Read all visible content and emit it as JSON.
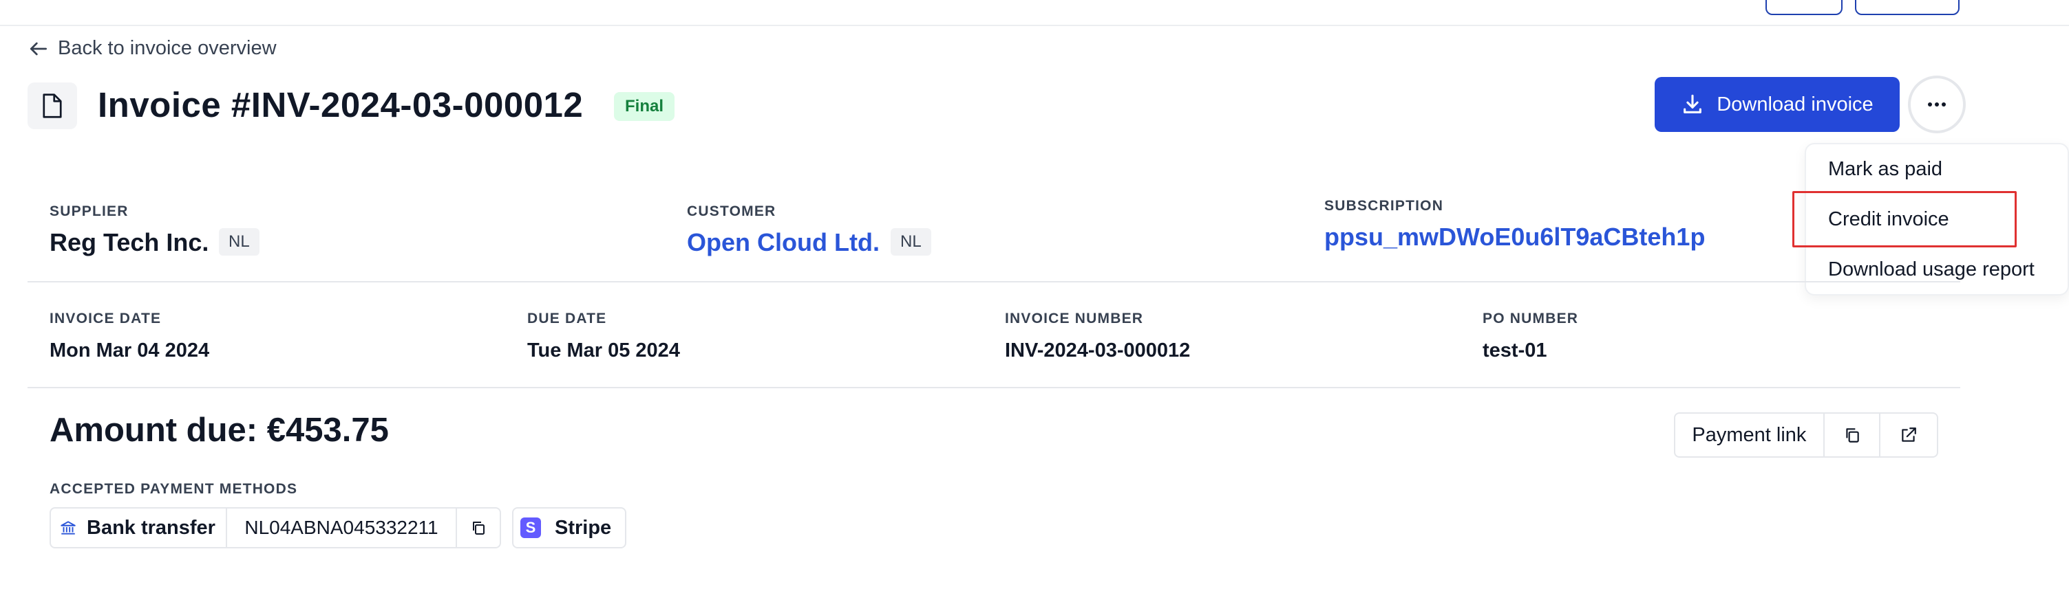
{
  "back_link": {
    "label": "Back to invoice overview"
  },
  "invoice": {
    "title": "Invoice #INV-2024-03-000012",
    "status": "Final"
  },
  "actions": {
    "download_label": "Download invoice",
    "more_menu": [
      "Mark as paid",
      "Credit invoice",
      "Download usage report"
    ]
  },
  "parties": {
    "supplier_label": "SUPPLIER",
    "supplier_name": "Reg Tech Inc.",
    "supplier_country": "NL",
    "customer_label": "CUSTOMER",
    "customer_name": "Open Cloud Ltd.",
    "customer_country": "NL",
    "subscription_label": "SUBSCRIPTION",
    "subscription_id": "ppsu_mwDWoE0u6lT9aCBteh1p"
  },
  "details": {
    "invoice_date_label": "INVOICE DATE",
    "invoice_date": "Mon Mar 04 2024",
    "due_date_label": "DUE DATE",
    "due_date": "Tue Mar 05 2024",
    "invoice_number_label": "INVOICE NUMBER",
    "invoice_number": "INV-2024-03-000012",
    "po_number_label": "PO NUMBER",
    "po_number": "test-01"
  },
  "payment": {
    "amount_due": "Amount due: €453.75",
    "payment_link_label": "Payment link",
    "methods_label": "ACCEPTED PAYMENT METHODS",
    "bank_transfer_label": "Bank transfer",
    "iban": "NL04ABNA045332211",
    "stripe_label": "Stripe",
    "stripe_logo_letter": "S"
  },
  "colors": {
    "primary": "#2448d8",
    "link": "#2a55d8",
    "badge_green_bg": "#dcfce7",
    "badge_green_text": "#15803d",
    "highlight": "#e03131",
    "stripe": "#635bff"
  }
}
